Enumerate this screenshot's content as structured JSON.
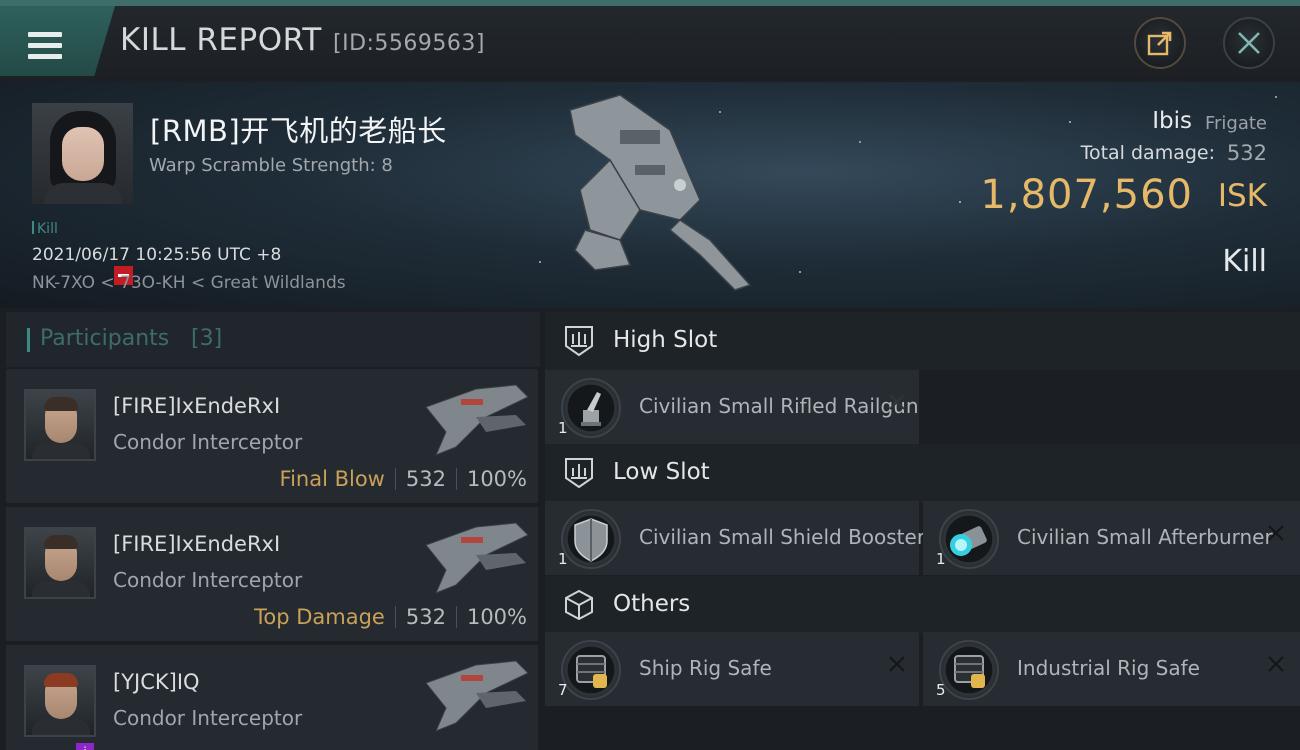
{
  "header": {
    "title": "KILL REPORT",
    "report_id": "[ID:5569563]",
    "menu_icon": "hamburger-menu-icon",
    "share_icon": "share-export-icon",
    "close_icon": "close-icon"
  },
  "victim": {
    "name": "[RMB]开飞机的老船长",
    "warp_scramble": "Warp Scramble Strength: 8",
    "tag": "Kill",
    "datetime": "2021/06/17 10:25:56 UTC +8",
    "location": "NK-7XO < 73O-KH < Great Wildlands",
    "ship_name": "Ibis",
    "ship_class": "Frigate",
    "total_damage_label": "Total damage:",
    "total_damage_value": "532",
    "isk_value": "1,807,560",
    "isk_unit": "ISK",
    "result": "Kill"
  },
  "participants": {
    "title": "Participants",
    "count": "[3]",
    "rows": [
      {
        "name": "[FIRE]IxEndeRxI",
        "ship": "Condor Interceptor",
        "role": "Final Blow",
        "damage": "532",
        "percent": "100%"
      },
      {
        "name": "[FIRE]IxEndeRxI",
        "ship": "Condor Interceptor",
        "role": "Top Damage",
        "damage": "532",
        "percent": "100%"
      },
      {
        "name": "[YJCK]IQ",
        "ship": "Condor Interceptor",
        "role": "",
        "damage": "",
        "percent": ""
      }
    ]
  },
  "fitting": {
    "high_slot": {
      "label": "High Slot",
      "modules": [
        {
          "name": "Civilian Small Rifled Railgun",
          "qty": "1",
          "icon": "railgun-icon"
        }
      ]
    },
    "low_slot": {
      "label": "Low Slot",
      "modules": [
        {
          "name": "Civilian Small Shield Booster",
          "qty": "1",
          "icon": "shield-booster-icon"
        },
        {
          "name": "Civilian Small Afterburner",
          "qty": "1",
          "icon": "afterburner-icon"
        }
      ]
    },
    "others": {
      "label": "Others",
      "modules": [
        {
          "name": "Ship Rig Safe",
          "qty": "7",
          "icon": "rig-safe-icon"
        },
        {
          "name": "Industrial Rig Safe",
          "qty": "5",
          "icon": "rig-safe-icon"
        }
      ]
    }
  },
  "colors": {
    "accent_teal": "#3f6e6a",
    "isk_gold": "#e6b969",
    "role_gold": "#c9a159",
    "corp_red": "#c21d24",
    "badge_purple": "#8e27c9"
  }
}
